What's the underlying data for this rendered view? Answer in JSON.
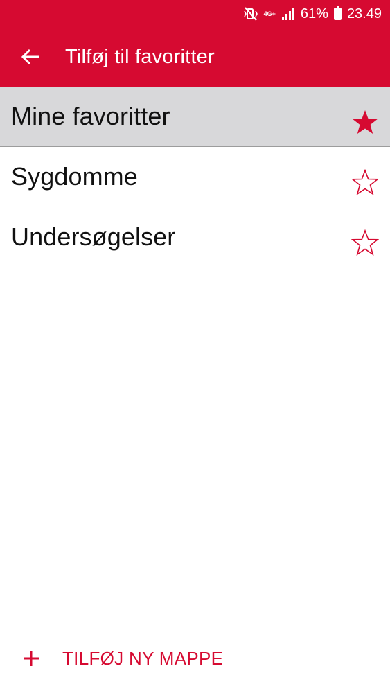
{
  "status_bar": {
    "battery_percent": "61%",
    "time": "23.49",
    "network_label": "4G+"
  },
  "toolbar": {
    "title": "Tilføj til favoritter",
    "back_icon": "arrow-left-icon"
  },
  "folders": [
    {
      "label": "Mine favoritter",
      "favorited": true
    },
    {
      "label": "Sygdomme",
      "favorited": false
    },
    {
      "label": "Undersøgelser",
      "favorited": false
    }
  ],
  "footer": {
    "add_folder_label": "TILFØJ NY MAPPE",
    "add_icon": "plus-icon"
  },
  "colors": {
    "accent": "#d60a31",
    "selected_row": "#d8d8da",
    "divider": "#9c9c9c"
  }
}
